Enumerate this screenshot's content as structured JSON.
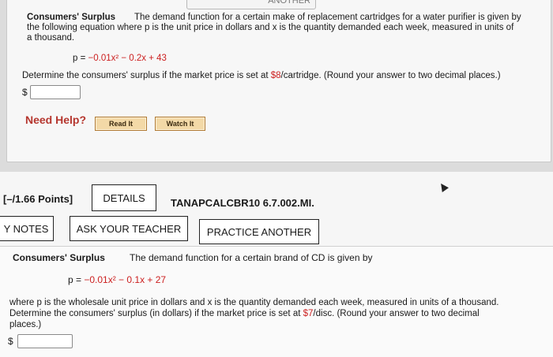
{
  "top_tab_stub": "ANOTHER",
  "q1": {
    "title": "Consumers' Surplus",
    "line1": "The demand function for a certain make of replacement cartridges for a water purifier is given by",
    "line2": "the following equation where p is the unit price in dollars and x is the quantity demanded each week, measured in units of",
    "line3": "a thousand.",
    "eq_lhs": "p = ",
    "eq_red": "−0.01x² − 0.2x + 43",
    "prompt_a": "Determine the consumers' surplus if the market price is set at ",
    "prompt_price": "$8",
    "prompt_b": "/cartridge. (Round your answer to two decimal places.)",
    "currency": "$",
    "answer_value": ""
  },
  "help": {
    "label": "Need Help?",
    "read_it": "Read It",
    "watch_it": "Watch It"
  },
  "q2_header": {
    "points": "[–/1.66 Points]",
    "details_button": "DETAILS",
    "code": "TANAPCALCBR10 6.7.002.MI."
  },
  "q2_tabs": {
    "my_notes": "Y NOTES",
    "ask_teacher": "ASK YOUR TEACHER",
    "practice_another": "PRACTICE ANOTHER"
  },
  "q2": {
    "title": "Consumers' Surplus",
    "intro": "The demand function for a certain brand of CD is given by",
    "eq_lhs": "p = ",
    "eq_red": "−0.01x² − 0.1x + 27",
    "line1": "where p is the wholesale unit price in dollars and x is the quantity demanded each week, measured in units of a thousand.",
    "line2a": "Determine the consumers' surplus (in dollars) if the market price is set at ",
    "line2_price": "$7",
    "line2b": "/disc. (Round your answer to two decimal",
    "line3": "places.)",
    "currency": "$",
    "answer_value": ""
  }
}
